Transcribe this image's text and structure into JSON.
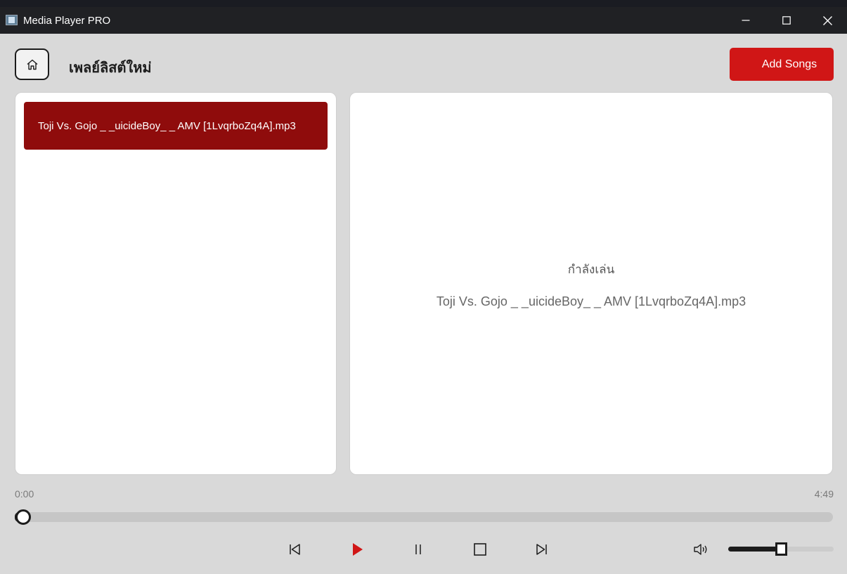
{
  "window": {
    "title": "Media Player PRO"
  },
  "header": {
    "playlist_title": "เพลย์ลิสต์ใหม่",
    "add_songs_label": "Add Songs",
    "home_icon": "home-icon"
  },
  "playlist": {
    "items": [
      {
        "label": "Toji Vs. Gojo _ _uicideBoy_ _ AMV [1LvqrboZq4A].mp3",
        "selected": true
      }
    ]
  },
  "now_playing": {
    "label": "กำลังเล่น",
    "track": "Toji Vs. Gojo _ _uicideBoy_ _ AMV [1LvqrboZq4A].mp3"
  },
  "progress": {
    "current": "0:00",
    "total": "4:49",
    "fraction": 0.01
  },
  "controls": {
    "icons": [
      "skip-previous-icon",
      "play-icon",
      "pause-icon",
      "stop-icon",
      "skip-next-icon"
    ]
  },
  "volume": {
    "icon": "volume-icon",
    "level": 0.5
  },
  "colors": {
    "accent": "#d01616",
    "selected_item": "#8f0c0c",
    "background": "#d9d9d9",
    "titlebar": "#202124"
  }
}
